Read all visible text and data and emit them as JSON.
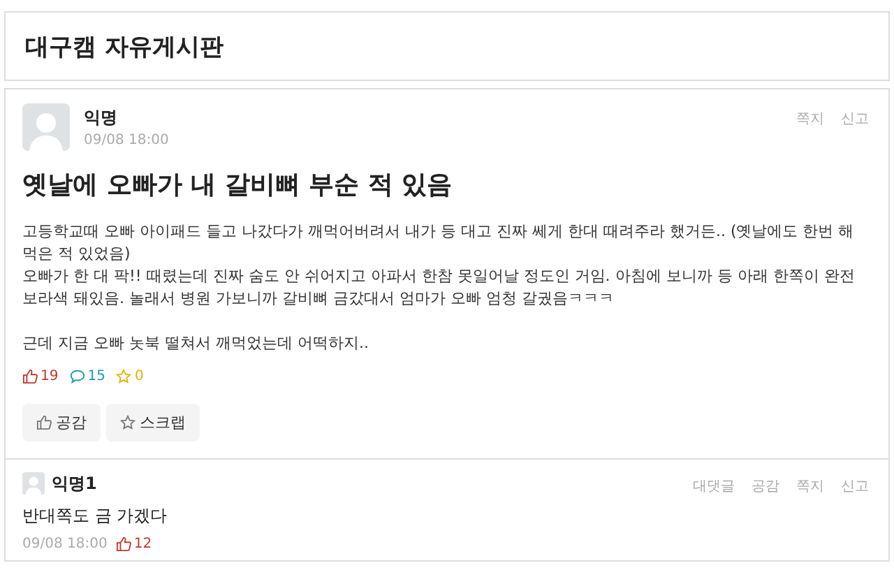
{
  "board": {
    "title": "대구캠 자유게시판"
  },
  "post": {
    "author": "익명",
    "time": "09/08 18:00",
    "actions": [
      "쪽지",
      "신고"
    ],
    "title": "옛날에 오빠가 내 갈비뼈 부순 적 있음",
    "paragraphs": [
      "고등학교때 오빠 아이패드 들고 나갔다가 깨먹어버려서 내가 등 대고 진짜 쎄게 한대 때려주라 했거든.. (옛날에도 한번 해먹은 적 있었음)\n오빠가 한 대 팍!! 때렸는데 진짜 숨도 안 쉬어지고 아파서 한참 못일어날 정도인 거임. 아침에 보니까 등 아래 한쪽이 완전 보라색 돼있음. 놀래서 병원 가보니까 갈비뼈 금갔대서 엄마가 오빠 엄청 갈궜음ㅋㅋㅋ",
      "근데 지금 오빠 놋북 떨쳐서 깨먹었는데 어떡하지.."
    ],
    "stats": [
      {
        "kind": "like",
        "count": "19"
      },
      {
        "kind": "comment",
        "count": "15"
      },
      {
        "kind": "scrap",
        "count": "0"
      }
    ],
    "buttons": [
      {
        "kind": "like",
        "label": "공감"
      },
      {
        "kind": "scrap",
        "label": "스크랩"
      }
    ]
  },
  "comments": [
    {
      "author": "익명1",
      "actions": [
        "대댓글",
        "공감",
        "쪽지",
        "신고"
      ],
      "text": "반대쪽도 금 가겠다",
      "time": "09/08 18:00",
      "likes": "12"
    }
  ]
}
